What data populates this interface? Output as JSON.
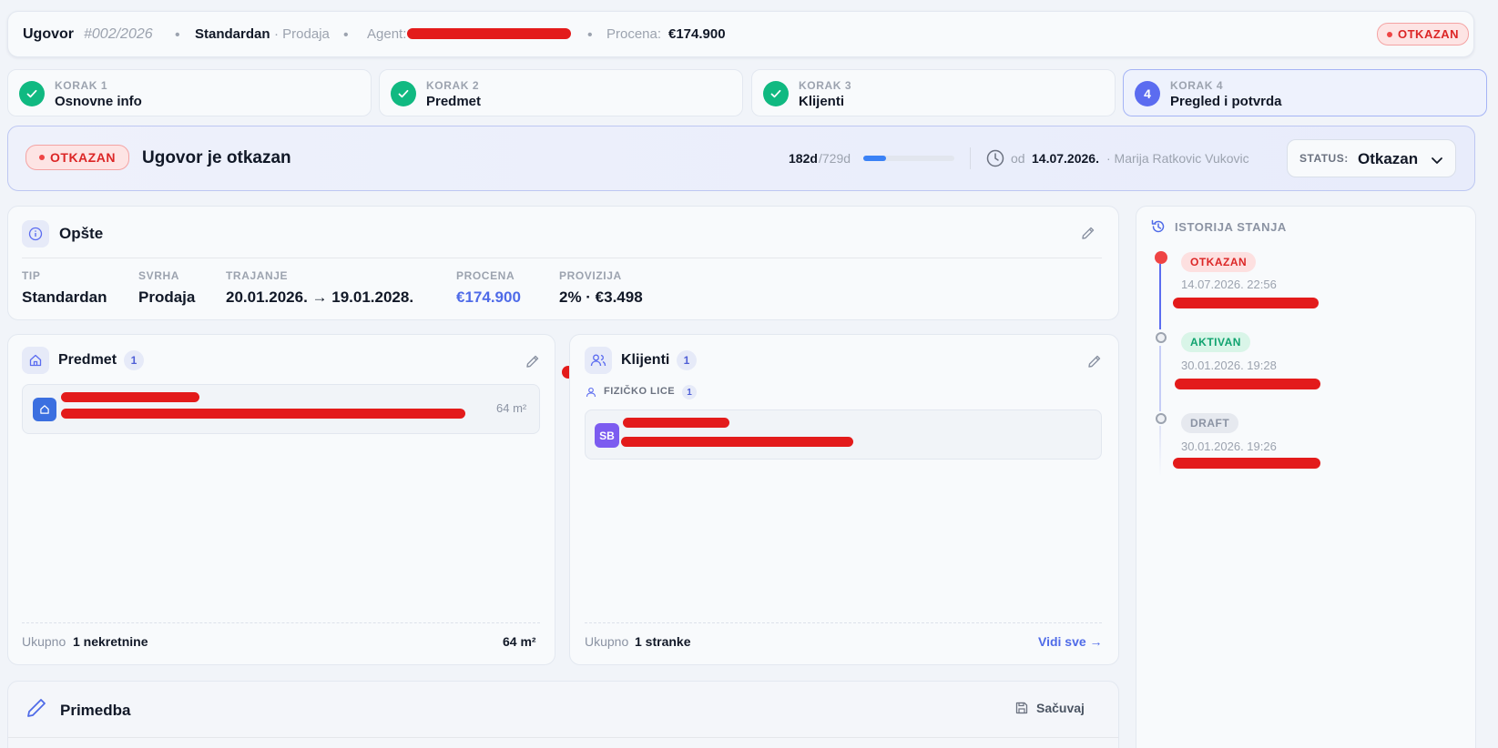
{
  "header": {
    "title": "Ugovor",
    "number": "#002/2026",
    "type": "Standardan",
    "purpose": "· Prodaja",
    "agent_label": "Agent:",
    "estimate_label": "Procena:",
    "estimate_value": "€174.900",
    "status_badge": "OTKAZAN"
  },
  "steps": [
    {
      "kicker": "KORAK 1",
      "name": "Osnovne info",
      "state": "done"
    },
    {
      "kicker": "KORAK 2",
      "name": "Predmet",
      "state": "done"
    },
    {
      "kicker": "KORAK 3",
      "name": "Klijenti",
      "state": "done"
    },
    {
      "kicker": "KORAK 4",
      "name": "Pregled i potvrda",
      "state": "active",
      "number": "4"
    }
  ],
  "banner": {
    "badge": "OTKAZAN",
    "title": "Ugovor je otkazan",
    "days_elapsed": "182d",
    "days_total": "/729d",
    "progress_fraction": 0.25,
    "since_label": "od",
    "since_date": "14.07.2026.",
    "by_user": "· Marija Ratkovic Vukovic",
    "status_label": "STATUS:",
    "status_value": "Otkazan"
  },
  "opste": {
    "title": "Opšte",
    "fields": [
      {
        "label": "TIP",
        "value": "Standardan"
      },
      {
        "label": "SVRHA",
        "value": "Prodaja"
      },
      {
        "label": "TRAJANJE",
        "value": "20.01.2026. → 19.01.2028."
      },
      {
        "label": "PROCENA",
        "value": "€174.900"
      },
      {
        "label": "PROVIZIJA",
        "value": "2% · €3.498"
      }
    ]
  },
  "predmet": {
    "title": "Predmet",
    "count": "1",
    "item_area": "64 m²",
    "footer_prefix": "Ukupno",
    "footer_count": "1 nekretnine",
    "footer_area": "64 m²"
  },
  "klijenti": {
    "title": "Klijenti",
    "count": "1",
    "group_label": "FIZIČKO LICE",
    "group_count": "1",
    "client_initials": "SB",
    "footer_prefix": "Ukupno",
    "footer_count": "1 stranke",
    "view_all": "Vidi sve →"
  },
  "primedba": {
    "title": "Primedba",
    "save_label": "Sačuvaj"
  },
  "history": {
    "title": "ISTORIJA STANJA",
    "entries": [
      {
        "status": "OTKAZAN",
        "time": "14.07.2026. 22:56"
      },
      {
        "status": "AKTIVAN",
        "time": "30.01.2026. 19:28"
      },
      {
        "status": "DRAFT",
        "time": "30.01.2026. 19:26"
      }
    ]
  },
  "colors": {
    "accent": "#5b6cf0",
    "success": "#10b981",
    "danger": "#dc2626",
    "price": "#4f6be8"
  }
}
